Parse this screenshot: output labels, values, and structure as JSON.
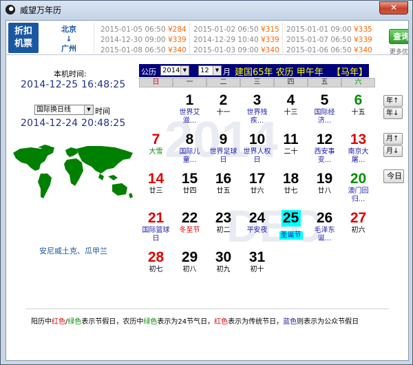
{
  "window": {
    "title": "威望万年历",
    "close": "✕"
  },
  "ad": {
    "badge_line1": "折扣",
    "badge_line2": "机票",
    "route_from": "北京",
    "route_arrow": "↓",
    "route_to": "广州",
    "col1": [
      {
        "time": "2015-01-05 06:50",
        "price": "¥284"
      },
      {
        "time": "2014-12-30 09:00",
        "price": "¥339"
      },
      {
        "time": "2015-01-08 06:50",
        "price": "¥340"
      }
    ],
    "col2": [
      {
        "time": "2015-01-02 06:50",
        "price": "¥315"
      },
      {
        "time": "2014-12-29 10:40",
        "price": "¥339"
      },
      {
        "time": "2015-01-03 09:00",
        "price": "¥340"
      }
    ],
    "col3": [
      {
        "time": "2015-01-01 09:00",
        "price": "¥335"
      },
      {
        "time": "2015-01-07 06:50",
        "price": "¥339"
      },
      {
        "time": "2015-01-06 06:50",
        "price": "¥340"
      }
    ],
    "button": "查询",
    "hint": "更多优惠"
  },
  "left": {
    "local_label": "本机时间:",
    "local_time": "2014-12-25 16:48:25",
    "tz_value": "国际换日线",
    "tz_suffix": "时间",
    "tz_time": "2014-12-24 20:48:25",
    "city": "安尼威土克、瓜甲兰",
    "map_color": "#008000"
  },
  "header": {
    "prefix": "公历",
    "year": "2014",
    "month": "12",
    "month_suffix": "月",
    "lunar_info": "建国65年 农历 甲午年",
    "zodiac": "【马年】"
  },
  "weekdays": [
    "日",
    "一",
    "二",
    "三",
    "四",
    "五",
    "六"
  ],
  "watermark": {
    "year": "2014",
    "month": "DEC"
  },
  "days": [
    {
      "n": "1",
      "col": 1,
      "row": 0,
      "sub": "世界艾滋...",
      "numc": "",
      "subc": "blue"
    },
    {
      "n": "2",
      "col": 2,
      "row": 0,
      "sub": "十一",
      "numc": "",
      "subc": ""
    },
    {
      "n": "3",
      "col": 3,
      "row": 0,
      "sub": "世界残疾...",
      "numc": "",
      "subc": "blue"
    },
    {
      "n": "4",
      "col": 4,
      "row": 0,
      "sub": "十三",
      "numc": "",
      "subc": ""
    },
    {
      "n": "5",
      "col": 5,
      "row": 0,
      "sub": "国际经济...",
      "numc": "",
      "subc": "blue"
    },
    {
      "n": "6",
      "col": 6,
      "row": 0,
      "sub": "十五",
      "numc": "green",
      "subc": ""
    },
    {
      "n": "7",
      "col": 0,
      "row": 1,
      "sub": "大雪",
      "numc": "red",
      "subc": "green"
    },
    {
      "n": "8",
      "col": 1,
      "row": 1,
      "sub": "国际儿童...",
      "numc": "",
      "subc": "blue"
    },
    {
      "n": "9",
      "col": 2,
      "row": 1,
      "sub": "世界足球日",
      "numc": "",
      "subc": "blue"
    },
    {
      "n": "10",
      "col": 3,
      "row": 1,
      "sub": "世界人权日",
      "numc": "",
      "subc": "blue"
    },
    {
      "n": "11",
      "col": 4,
      "row": 1,
      "sub": "二十",
      "numc": "",
      "subc": ""
    },
    {
      "n": "12",
      "col": 5,
      "row": 1,
      "sub": "西安事变...",
      "numc": "",
      "subc": "blue"
    },
    {
      "n": "13",
      "col": 6,
      "row": 1,
      "sub": "南京大屠...",
      "numc": "red",
      "subc": "blue"
    },
    {
      "n": "14",
      "col": 0,
      "row": 2,
      "sub": "廿三",
      "numc": "red",
      "subc": ""
    },
    {
      "n": "15",
      "col": 1,
      "row": 2,
      "sub": "廿四",
      "numc": "",
      "subc": ""
    },
    {
      "n": "16",
      "col": 2,
      "row": 2,
      "sub": "廿五",
      "numc": "",
      "subc": ""
    },
    {
      "n": "17",
      "col": 3,
      "row": 2,
      "sub": "廿六",
      "numc": "",
      "subc": ""
    },
    {
      "n": "18",
      "col": 4,
      "row": 2,
      "sub": "廿七",
      "numc": "",
      "subc": ""
    },
    {
      "n": "19",
      "col": 5,
      "row": 2,
      "sub": "廿八",
      "numc": "",
      "subc": ""
    },
    {
      "n": "20",
      "col": 6,
      "row": 2,
      "sub": "澳门回归...",
      "numc": "green",
      "subc": "blue"
    },
    {
      "n": "21",
      "col": 0,
      "row": 3,
      "sub": "国际篮球日",
      "numc": "red",
      "subc": "blue"
    },
    {
      "n": "22",
      "col": 1,
      "row": 3,
      "sub": "冬至节",
      "numc": "",
      "subc": "red"
    },
    {
      "n": "23",
      "col": 2,
      "row": 3,
      "sub": "初二",
      "numc": "",
      "subc": ""
    },
    {
      "n": "24",
      "col": 3,
      "row": 3,
      "sub": "平安夜",
      "numc": "",
      "subc": "blue"
    },
    {
      "n": "25",
      "col": 4,
      "row": 3,
      "sub": "圣诞节",
      "numc": "today",
      "subc": "todaysub"
    },
    {
      "n": "26",
      "col": 5,
      "row": 3,
      "sub": "毛泽东诞...",
      "numc": "",
      "subc": "blue"
    },
    {
      "n": "27",
      "col": 6,
      "row": 3,
      "sub": "初六",
      "numc": "red",
      "subc": ""
    },
    {
      "n": "28",
      "col": 0,
      "row": 4,
      "sub": "初七",
      "numc": "red",
      "subc": ""
    },
    {
      "n": "29",
      "col": 1,
      "row": 4,
      "sub": "初八",
      "numc": "",
      "subc": ""
    },
    {
      "n": "30",
      "col": 2,
      "row": 4,
      "sub": "初九",
      "numc": "",
      "subc": ""
    },
    {
      "n": "31",
      "col": 3,
      "row": 4,
      "sub": "初十",
      "numc": "",
      "subc": ""
    }
  ],
  "nav": {
    "year_up": "年↑",
    "year_down": "年↓",
    "month_up": "月↑",
    "month_down": "月↓",
    "today": "今日"
  },
  "legend": {
    "p1": "阳历中",
    "p2": "红色",
    "p3": "/",
    "p4": "绿色",
    "p5": "表示节假日，农历中",
    "p6": "绿色",
    "p7": "表示为24节气日，",
    "p8": "红色",
    "p9": "表示为传统节日，",
    "p10": "蓝色",
    "p11": "则表示为公众节假日"
  }
}
